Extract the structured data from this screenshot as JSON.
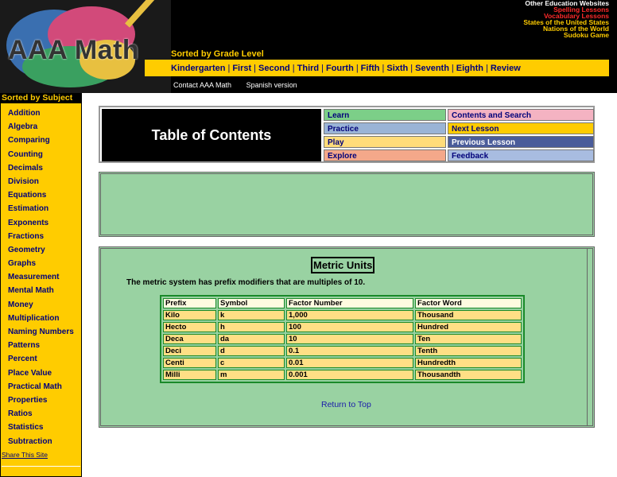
{
  "brand": {
    "logo_text": "AAA Math"
  },
  "header": {
    "other_links": [
      {
        "label": "Other Education Websites",
        "color": "white"
      },
      {
        "label": "Spelling Lessons",
        "color": "red"
      },
      {
        "label": "Vocabulary Lessons",
        "color": "red"
      },
      {
        "label": "States of the United States",
        "color": "yellow"
      },
      {
        "label": "Nations of the World",
        "color": "yellow"
      },
      {
        "label": "Sudoku Game",
        "color": "yellow"
      }
    ],
    "sorted_by_grade": "Sorted by Grade Level",
    "grades": [
      "Kindergarten",
      "First",
      "Second",
      "Third",
      "Fourth",
      "Fifth",
      "Sixth",
      "Seventh",
      "Eighth",
      "Review"
    ],
    "contact": "Contact AAA Math",
    "spanish": "Spanish version"
  },
  "sidebar": {
    "heading": "Sorted by Subject",
    "items": [
      "Addition",
      "Algebra",
      "Comparing",
      "Counting",
      "Decimals",
      "Division",
      "Equations",
      "Estimation",
      "Exponents",
      "Fractions",
      "Geometry",
      "Graphs",
      "Measurement",
      "Mental Math",
      "Money",
      "Multiplication",
      "Naming Numbers",
      "Patterns",
      "Percent",
      "Place Value",
      "Practical Math",
      "Properties",
      "Ratios",
      "Statistics",
      "Subtraction"
    ],
    "share": "Share This Site"
  },
  "toc": {
    "title": "Table of Contents",
    "learn": "Learn",
    "practice": "Practice",
    "play": "Play",
    "explore": "Explore",
    "contents_search": "Contents and Search",
    "next_lesson": "Next Lesson",
    "previous_lesson": "Previous Lesson",
    "feedback": "Feedback"
  },
  "lesson": {
    "title": "Metric Units",
    "intro": "The metric system has prefix modifiers that are multiples of 10.",
    "table": {
      "headers": [
        "Prefix",
        "Symbol",
        "Factor Number",
        "Factor Word"
      ],
      "rows": [
        [
          "Kilo",
          "k",
          "1,000",
          "Thousand"
        ],
        [
          "Hecto",
          "h",
          "100",
          "Hundred"
        ],
        [
          "Deca",
          "da",
          "10",
          "Ten"
        ],
        [
          "Deci",
          "d",
          "0.1",
          "Tenth"
        ],
        [
          "Centi",
          "c",
          "0.01",
          "Hundredth"
        ],
        [
          "Milli",
          "m",
          "0.001",
          "Thousandth"
        ]
      ]
    },
    "return_top": "Return to Top"
  },
  "colors": {
    "accent_yellow": "#ffcc00",
    "content_green": "#99d2a2",
    "nav_blue": "#00007a",
    "learn_green": "#7ccf88",
    "practice_blue": "#9ab4d6",
    "play_yellow": "#ffdc7a",
    "explore_salmon": "#f4a88a",
    "contents_pink": "#f4b3c2",
    "next_yellow": "#ffcc00",
    "previous_blue": "#4a5c9a",
    "feedback_lilac": "#a8bce0"
  }
}
